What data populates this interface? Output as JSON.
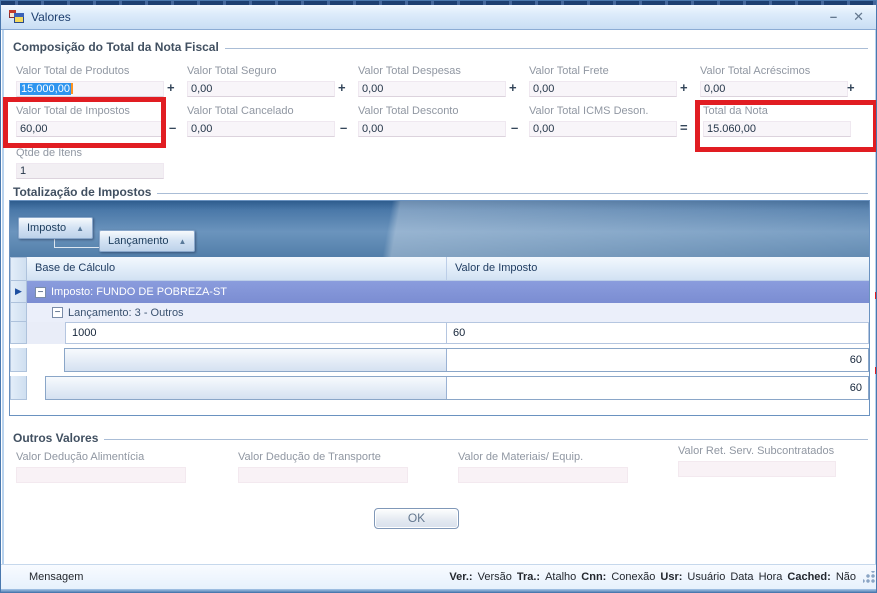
{
  "window": {
    "title": "Valores",
    "minimize_glyph": "–",
    "close_glyph": "✕"
  },
  "icons": {
    "sort_asc": "▲",
    "collapse": "−",
    "row_focus": "▶"
  },
  "colors": {
    "annotation_red": "#e11d22",
    "selection_blue": "#2f95ef",
    "selection_caret_orange": "#ff9321",
    "selected_group_row": "#8092d7",
    "group_panel_blue": "#4a78a8"
  },
  "composicao": {
    "title": "Composição do Total da Nota Fiscal",
    "row1": [
      {
        "label": "Valor Total de Produtos",
        "value": "15.000,00",
        "op": "+"
      },
      {
        "label": "Valor Total Seguro",
        "value": "0,00",
        "op": "+"
      },
      {
        "label": "Valor Total Despesas",
        "value": "0,00",
        "op": "+"
      },
      {
        "label": "Valor Total Frete",
        "value": "0,00",
        "op": "+"
      },
      {
        "label": "Valor Total Acréscimos",
        "value": "0,00",
        "op": "+"
      }
    ],
    "row2": [
      {
        "label": "Valor Total de Impostos",
        "value": "60,00",
        "op": "–"
      },
      {
        "label": "Valor Total Cancelado",
        "value": "0,00",
        "op": "–"
      },
      {
        "label": "Valor Total Desconto",
        "value": "0,00",
        "op": "–"
      },
      {
        "label": "Valor Total ICMS Deson.",
        "value": "0,00",
        "op": "="
      },
      {
        "label": "Total da Nota",
        "value": "15.060,00",
        "op": ""
      }
    ],
    "qtde": {
      "label": "Qtde de Itens",
      "value": "1"
    }
  },
  "totalizacao": {
    "title": "Totalização de Impostos",
    "group_buttons": [
      {
        "label": "Imposto"
      },
      {
        "label": "Lançamento"
      }
    ],
    "columns": [
      "Base de Cálculo",
      "Valor de Imposto"
    ],
    "rows": {
      "group1": "Imposto: FUNDO DE POBREZA-ST",
      "group2": "Lançamento: 3 - Outros",
      "data": {
        "base": "1000",
        "valor": "60"
      },
      "group_footer": "60",
      "grand_total": "60"
    }
  },
  "outros": {
    "title": "Outros Valores",
    "fields": [
      {
        "label": "Valor Dedução Alimentícia",
        "value": ""
      },
      {
        "label": "Valor Dedução de Transporte",
        "value": ""
      },
      {
        "label": "Valor de Materiais/ Equip.",
        "value": ""
      },
      {
        "label": "Valor Ret. Serv. Subcontratados",
        "value": ""
      }
    ]
  },
  "ok_label": "OK",
  "statusbar": {
    "left": "Mensagem",
    "items": [
      {
        "k": "Ver.:",
        "v": "Versão"
      },
      {
        "k": "Tra.:",
        "v": "Atalho"
      },
      {
        "k": "Cnn:",
        "v": "Conexão"
      },
      {
        "k": "Usr:",
        "v": "Usuário"
      },
      {
        "k": "",
        "v": "Data"
      },
      {
        "k": "",
        "v": "Hora"
      },
      {
        "k": "Cached:",
        "v": "Não"
      }
    ]
  }
}
